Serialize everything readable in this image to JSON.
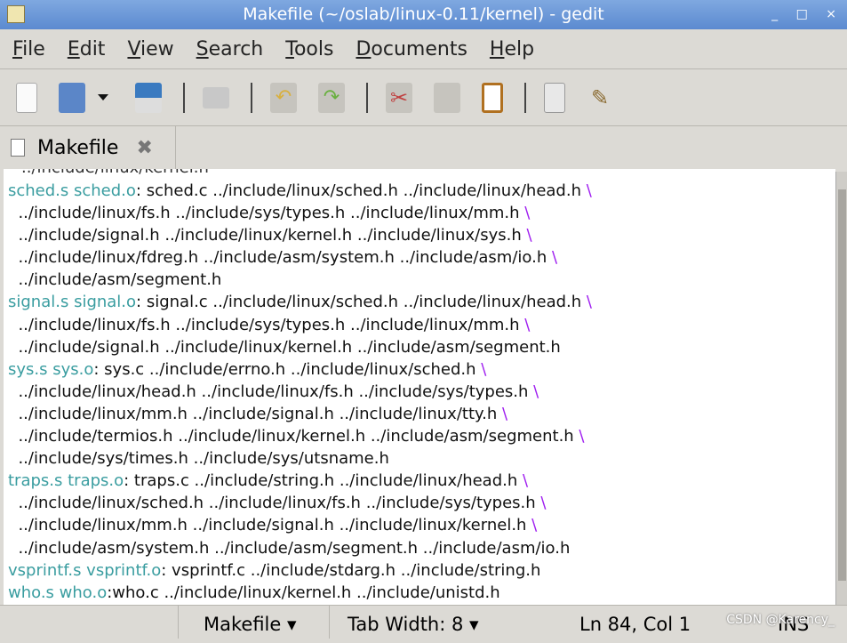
{
  "window": {
    "title": "Makefile (~/oslab/linux-0.11/kernel) - gedit",
    "controls": "_ □ ×"
  },
  "menu": [
    "File",
    "Edit",
    "View",
    "Search",
    "Tools",
    "Documents",
    "Help"
  ],
  "tab": {
    "label": "Makefile",
    "close": "✖"
  },
  "editor": {
    "clipped_line": "../include/linux/kernel.h",
    "lines": [
      {
        "t": "sched.s sched.o",
        "r": ": sched.c ../include/linux/sched.h ../include/linux/head.h ",
        "b": "\\"
      },
      {
        "t": "",
        "r": "  ../include/linux/fs.h ../include/sys/types.h ../include/linux/mm.h ",
        "b": "\\"
      },
      {
        "t": "",
        "r": "  ../include/signal.h ../include/linux/kernel.h ../include/linux/sys.h ",
        "b": "\\"
      },
      {
        "t": "",
        "r": "  ../include/linux/fdreg.h ../include/asm/system.h ../include/asm/io.h ",
        "b": "\\"
      },
      {
        "t": "",
        "r": "  ../include/asm/segment.h",
        "b": ""
      },
      {
        "t": "signal.s signal.o",
        "r": ": signal.c ../include/linux/sched.h ../include/linux/head.h ",
        "b": "\\"
      },
      {
        "t": "",
        "r": "  ../include/linux/fs.h ../include/sys/types.h ../include/linux/mm.h ",
        "b": "\\"
      },
      {
        "t": "",
        "r": "  ../include/signal.h ../include/linux/kernel.h ../include/asm/segment.h",
        "b": ""
      },
      {
        "t": "sys.s sys.o",
        "r": ": sys.c ../include/errno.h ../include/linux/sched.h ",
        "b": "\\"
      },
      {
        "t": "",
        "r": "  ../include/linux/head.h ../include/linux/fs.h ../include/sys/types.h ",
        "b": "\\"
      },
      {
        "t": "",
        "r": "  ../include/linux/mm.h ../include/signal.h ../include/linux/tty.h ",
        "b": "\\"
      },
      {
        "t": "",
        "r": "  ../include/termios.h ../include/linux/kernel.h ../include/asm/segment.h ",
        "b": "\\"
      },
      {
        "t": "",
        "r": "  ../include/sys/times.h ../include/sys/utsname.h",
        "b": ""
      },
      {
        "t": "traps.s traps.o",
        "r": ": traps.c ../include/string.h ../include/linux/head.h ",
        "b": "\\"
      },
      {
        "t": "",
        "r": "  ../include/linux/sched.h ../include/linux/fs.h ../include/sys/types.h ",
        "b": "\\"
      },
      {
        "t": "",
        "r": "  ../include/linux/mm.h ../include/signal.h ../include/linux/kernel.h ",
        "b": "\\"
      },
      {
        "t": "",
        "r": "  ../include/asm/system.h ../include/asm/segment.h ../include/asm/io.h",
        "b": ""
      },
      {
        "t": "vsprintf.s vsprintf.o",
        "r": ": vsprintf.c ../include/stdarg.h ../include/string.h",
        "b": ""
      },
      {
        "t": "who.s who.o",
        "r": ":who.c ../include/linux/kernel.h ../include/unistd.h",
        "b": ""
      }
    ]
  },
  "status": {
    "language": "Makefile ▾",
    "tab_width": "Tab Width:  8 ▾",
    "position": "Ln 84, Col 1",
    "mode": "INS"
  },
  "watermark": "CSDN @Karency_"
}
